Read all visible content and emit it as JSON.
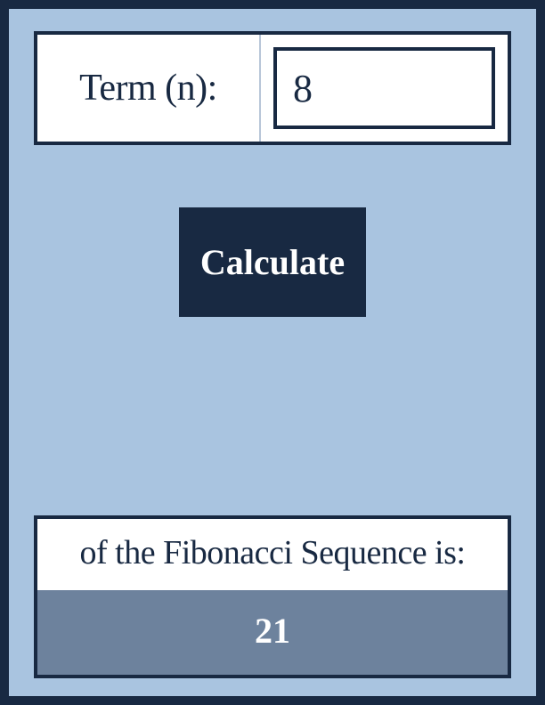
{
  "input": {
    "label": "Term (n):",
    "value": "8"
  },
  "button": {
    "calculate_label": "Calculate"
  },
  "result": {
    "label": "of the Fibonacci Sequence is:",
    "value": "21"
  }
}
